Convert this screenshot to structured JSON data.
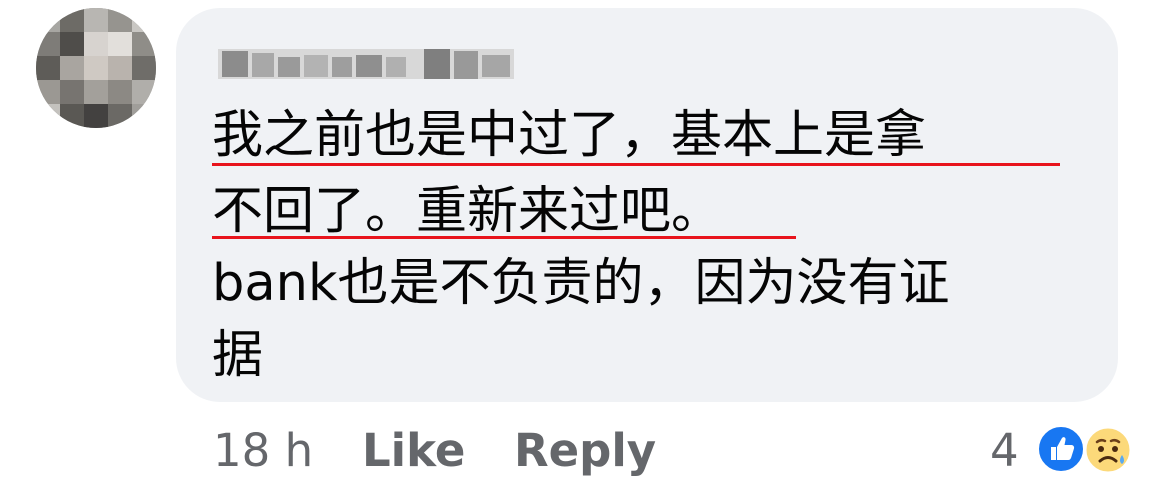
{
  "comment": {
    "lines": [
      "我之前也是中过了，基本上是拿",
      "不回了。重新来过吧。",
      "bank也是不负责的，因为没有证",
      "据"
    ]
  },
  "actions": {
    "time": "18 h",
    "like": "Like",
    "reply": "Reply"
  },
  "reactions": {
    "count": "4",
    "icons": [
      "like-icon",
      "sad-icon"
    ]
  },
  "colors": {
    "bubble": "#f0f2f5",
    "meta": "#65676b",
    "underline": "#e8141c",
    "like_blue": "#1877f2"
  }
}
